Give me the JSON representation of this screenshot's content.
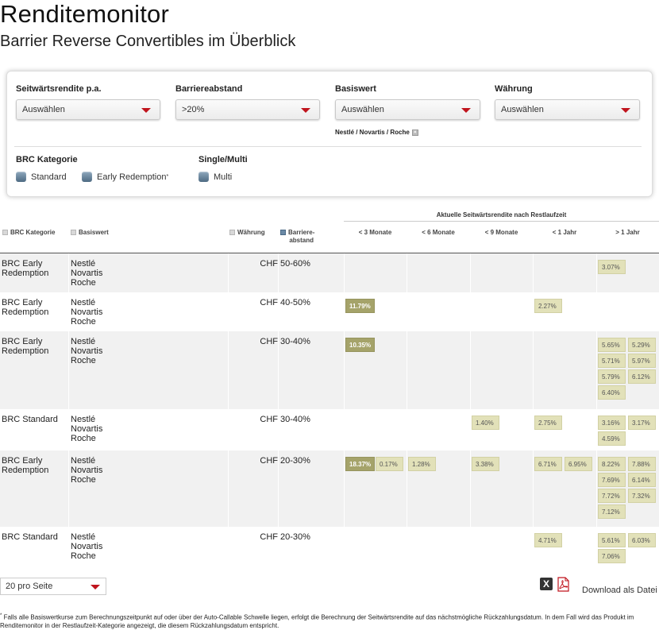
{
  "header": {
    "title": "Renditemonitor",
    "subtitle": "Barrier Reverse Convertibles im Überblick"
  },
  "filters": {
    "seitwaerts": {
      "label": "Seitwärtsrendite p.a.",
      "value": "Auswählen"
    },
    "barriere": {
      "label": "Barriereabstand",
      "value": ">20%"
    },
    "basiswert": {
      "label": "Basiswert",
      "value": "Auswählen",
      "selected_note": "Nestlé / Novartis / Roche"
    },
    "waehrung": {
      "label": "Währung",
      "value": "Auswählen"
    },
    "kategorie": {
      "label": "BRC Kategorie",
      "options": [
        "Standard",
        "Early Redemption"
      ],
      "footnote_marker": "*"
    },
    "single_multi": {
      "label": "Single/Multi",
      "options": [
        "Multi"
      ]
    }
  },
  "table": {
    "group_header": "Aktuelle Seitwärtsrendite nach Restlaufzeit",
    "headers": {
      "kategorie": "BRC Kategorie",
      "basiswert": "Basiswert",
      "waehrung": "Währung",
      "barriere": "Barriere-\nabstand",
      "t1": "< 3 Monate",
      "t2": "< 6 Monate",
      "t3": "< 9 Monate",
      "t4": "< 1 Jahr",
      "t5": "> 1 Jahr"
    },
    "rows": [
      {
        "kategorie": "BRC Early\nRedemption",
        "basiswert": "Nestlé\nNovartis\nRoche",
        "waehrung": "CHF",
        "barriere": "50-60%",
        "cols": [
          [],
          [],
          [],
          [],
          [
            "3.07%"
          ]
        ]
      },
      {
        "kategorie": "BRC Early\nRedemption",
        "basiswert": "Nestlé\nNovartis\nRoche",
        "waehrung": "CHF",
        "barriere": "40-50%",
        "cols": [
          [
            "11.79%"
          ],
          [],
          [],
          [
            "2.27%"
          ],
          []
        ]
      },
      {
        "kategorie": "BRC Early\nRedemption",
        "basiswert": "Nestlé\nNovartis\nRoche",
        "waehrung": "CHF",
        "barriere": "30-40%",
        "cols": [
          [
            "10.35%"
          ],
          [],
          [],
          [],
          [
            "5.65%",
            "5.29%",
            "5.71%",
            "5.97%",
            "5.79%",
            "6.12%",
            "6.40%"
          ]
        ]
      },
      {
        "kategorie": "BRC Standard",
        "basiswert": "Nestlé\nNovartis\nRoche",
        "waehrung": "CHF",
        "barriere": "30-40%",
        "cols": [
          [],
          [],
          [
            "1.40%"
          ],
          [
            "2.75%"
          ],
          [
            "3.16%",
            "3.17%",
            "4.59%"
          ]
        ]
      },
      {
        "kategorie": "BRC Early\nRedemption",
        "basiswert": "Nestlé\nNovartis\nRoche",
        "waehrung": "CHF",
        "barriere": "20-30%",
        "cols": [
          [
            "18.37%",
            "0.17%"
          ],
          [
            "1.28%"
          ],
          [
            "3.38%"
          ],
          [
            "6.71%",
            "6.95%"
          ],
          [
            "8.22%",
            "7.88%",
            "7.69%",
            "6.14%",
            "7.72%",
            "7.32%",
            "7.12%"
          ]
        ]
      },
      {
        "kategorie": "BRC Standard",
        "basiswert": "Nestlé\nNovartis\nRoche",
        "waehrung": "CHF",
        "barriere": "20-30%",
        "cols": [
          [],
          [],
          [],
          [
            "4.71%"
          ],
          [
            "5.61%",
            "6.03%",
            "7.06%"
          ]
        ]
      }
    ]
  },
  "pagination": {
    "per_page": "20 pro Seite"
  },
  "download": {
    "label": "Download als Datei",
    "xls_icon": "excel-icon",
    "pdf_icon": "pdf-icon"
  },
  "footnote": {
    "marker": "*",
    "text": "Falls alle Basiswertkurse zum Berechnungszeitpunkt auf oder über der Auto-Callable Schwelle liegen, erfolgt die Berechnung der Seitwärtsrendite auf das nächstmögliche Rückzahlungsdatum. In dem Fall wird das Produkt im Renditemonitor in der Restlaufzeit-Kategorie angezeigt, die diesem Rückzahlungsdatum entspricht."
  },
  "colors": {
    "accent": "#c0141d",
    "badge": "#e2e1b9",
    "badge_dark": "#a5a36a",
    "row_shade": "#f1f1f1"
  }
}
